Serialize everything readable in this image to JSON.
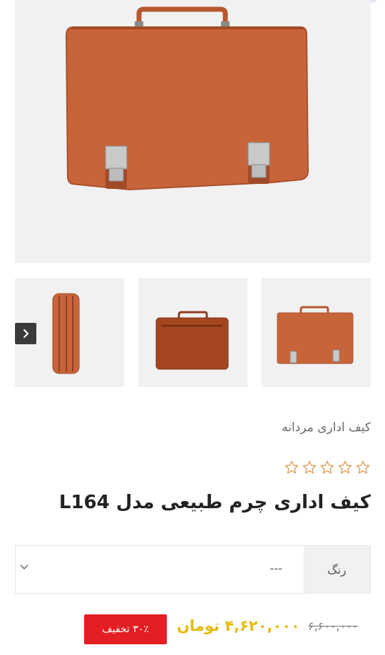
{
  "product": {
    "category": "کیف اداری مردانه",
    "title": "کیف اداری چرم طبیعی مدل L164",
    "rating_stars": 5,
    "rating_value": 0
  },
  "gallery": {
    "main_image": "briefcase-front",
    "thumbnails": [
      "briefcase-front",
      "briefcase-back",
      "briefcase-side"
    ]
  },
  "variation": {
    "label": "رنگ",
    "selected": "---"
  },
  "price": {
    "old": "۶,۶۰۰,۰۰۰",
    "new": "۴,۶۲۰,۰۰۰ تومان",
    "discount": "۳۰٪ تخفیف"
  },
  "colors": {
    "leather": "#c8643a",
    "price": "#e7b90c",
    "discount": "#e31e24",
    "star": "#e29a55"
  }
}
